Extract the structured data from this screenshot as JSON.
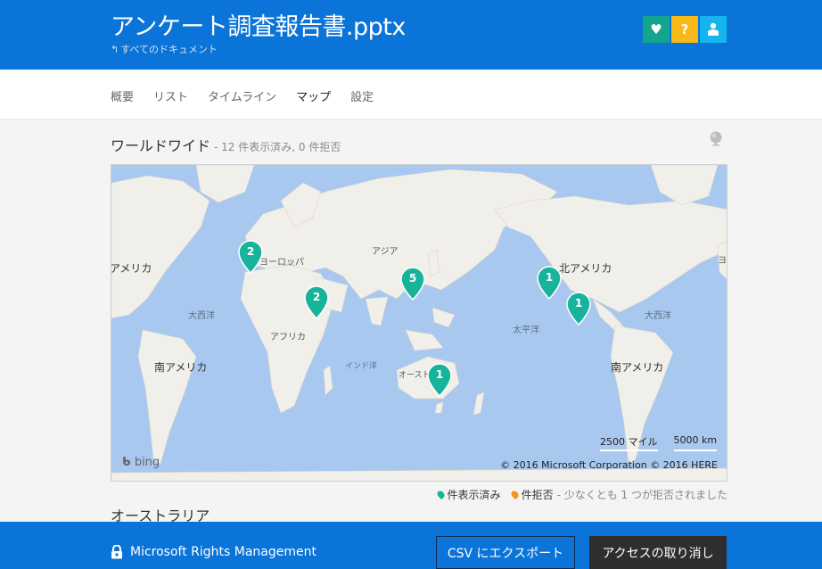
{
  "header": {
    "title": "アンケート調査報告書.pptx",
    "back_link": "すべてのドキュメント",
    "icons": [
      "heart-icon",
      "help-icon",
      "user-icon"
    ],
    "colors": {
      "bar": "#0a74d8",
      "heart": "#14a58f",
      "help": "#f6b918",
      "user": "#15b4ef"
    }
  },
  "tabs": [
    {
      "label": "概要"
    },
    {
      "label": "リスト"
    },
    {
      "label": "タイムライン"
    },
    {
      "label": "マップ",
      "active": true
    },
    {
      "label": "設定"
    }
  ],
  "section": {
    "title": "ワールドワイド",
    "subtitle": "- 12 件表示済み, 0 件拒否"
  },
  "map": {
    "labels": {
      "america_left": "アメリカ",
      "europe": "ヨーロッパ",
      "asia": "アジア",
      "north_america": "北アメリカ",
      "europe_right": "ヨーロッ",
      "atlantic_left": "大西洋",
      "atlantic_right": "大西洋",
      "africa": "アフリカ",
      "pacific": "太平洋",
      "south_america_left": "南アメリカ",
      "south_america_right": "南アメリカ",
      "indian_ocean": "インド洋",
      "australia": "オースト"
    },
    "pins": [
      {
        "count": "2",
        "region": "europe"
      },
      {
        "count": "2",
        "region": "middle-east"
      },
      {
        "count": "5",
        "region": "east-asia"
      },
      {
        "count": "1",
        "region": "australia"
      },
      {
        "count": "1",
        "region": "north-america-west"
      },
      {
        "count": "1",
        "region": "north-america-south"
      }
    ],
    "scale_miles": "2500 マイル",
    "scale_km": "5000 km",
    "logo": "bing",
    "copyright": "© 2016 Microsoft Corporation    © 2016 HERE",
    "pin_color": "#17b39a"
  },
  "legend": {
    "shown": "件表示済み",
    "rejected": "件拒否",
    "note": "- 少なくとも 1 つが拒否されました",
    "colors": {
      "shown": "#17b39a",
      "rejected": "#f7941d"
    }
  },
  "subsection": {
    "title": "オーストラリア"
  },
  "footer": {
    "rm_label": "Microsoft Rights Management",
    "export_button": "CSV にエクスポート",
    "revoke_button": "アクセスの取り消し"
  }
}
